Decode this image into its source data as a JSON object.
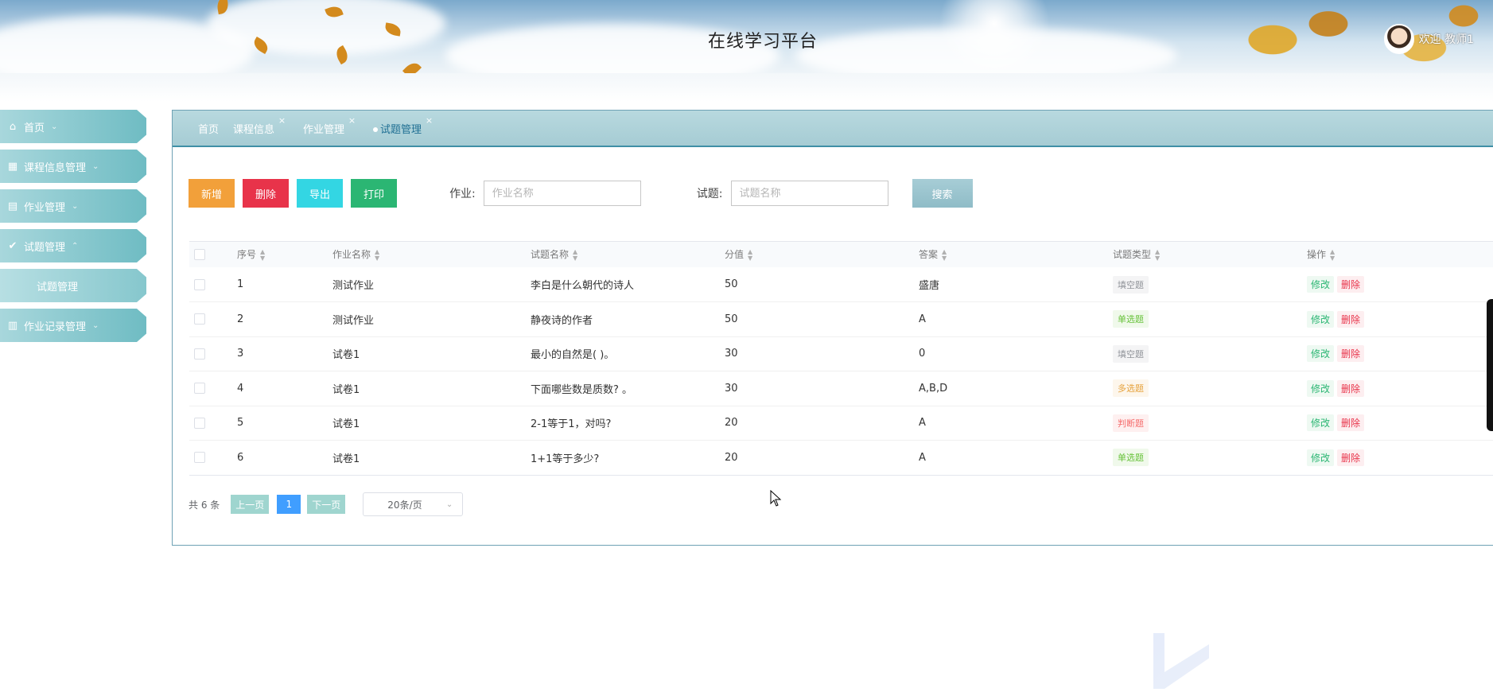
{
  "header": {
    "title": "在线学习平台",
    "welcome": "欢迎 教师1"
  },
  "sidebar": {
    "items": [
      {
        "label": "首页",
        "icon": "home-icon"
      },
      {
        "label": "课程信息管理",
        "icon": "grid-icon"
      },
      {
        "label": "作业管理",
        "icon": "folder-icon"
      },
      {
        "label": "试题管理",
        "icon": "check-circle-icon"
      },
      {
        "label": "试题管理",
        "icon": ""
      },
      {
        "label": "作业记录管理",
        "icon": "book-icon"
      }
    ]
  },
  "tabs": [
    {
      "label": "首页"
    },
    {
      "label": "课程信息"
    },
    {
      "label": "作业管理"
    },
    {
      "label": "试题管理"
    }
  ],
  "toolbar": {
    "add": "新增",
    "delete": "删除",
    "export": "导出",
    "print": "打印",
    "homework_label": "作业:",
    "homework_placeholder": "作业名称",
    "question_label": "试题:",
    "question_placeholder": "试题名称",
    "search": "搜索"
  },
  "table": {
    "headers": [
      "序号",
      "作业名称",
      "试题名称",
      "分值",
      "答案",
      "试题类型",
      "操作"
    ],
    "rows": [
      {
        "no": "1",
        "homework": "测试作业",
        "question": "李白是什么朝代的诗人",
        "score": "50",
        "answer": "盛唐",
        "type": "填空题"
      },
      {
        "no": "2",
        "homework": "测试作业",
        "question": "静夜诗的作者",
        "score": "50",
        "answer": "A",
        "type": "单选题"
      },
      {
        "no": "3",
        "homework": "试卷1",
        "question": "最小的自然是( )。",
        "score": "30",
        "answer": "0",
        "type": "填空题"
      },
      {
        "no": "4",
        "homework": "试卷1",
        "question": "下面哪些数是质数? 。",
        "score": "30",
        "answer": "A,B,D",
        "type": "多选题"
      },
      {
        "no": "5",
        "homework": "试卷1",
        "question": "2-1等于1，对吗?",
        "score": "20",
        "answer": "A",
        "type": "判断题"
      },
      {
        "no": "6",
        "homework": "试卷1",
        "question": "1+1等于多少?",
        "score": "20",
        "answer": "A",
        "type": "单选题"
      }
    ],
    "edit_label": "修改",
    "delete_label": "删除"
  },
  "type_colors": {
    "填空题": {
      "fg": "#909399",
      "bg": "#f4f4f5"
    },
    "单选题": {
      "fg": "#67c23a",
      "bg": "#f0f9eb"
    },
    "多选题": {
      "fg": "#e6a23c",
      "bg": "#fdf6ec"
    },
    "判断题": {
      "fg": "#f56c6c",
      "bg": "#fef0f0"
    }
  },
  "pagination": {
    "total": "共 6 条",
    "prev": "上一页",
    "page": "1",
    "next": "下一页",
    "page_size": "20条/页"
  }
}
